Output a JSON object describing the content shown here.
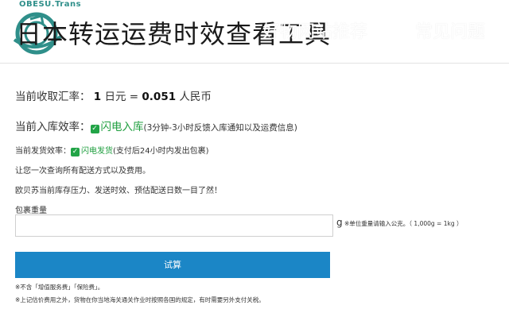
{
  "header": {
    "logo_text": "OBESU.Trans",
    "site_title": "日本转运运费时效查看工具",
    "nav": [
      "好物网站推荐",
      "常见问题"
    ]
  },
  "rate": {
    "label": "当前收取汇率：",
    "jpy": "1",
    "jpy_unit": "日元 =",
    "cny": "0.051",
    "cny_unit": "人民币"
  },
  "intake": {
    "label": "当前入库效率：",
    "status": "闪电入库",
    "note": "(3分钟-3小时反馈入库通知以及运费信息)"
  },
  "shipping": {
    "label": "当前发货效率：",
    "status": "闪电发货",
    "note": "(支付后24小时内发出包裹)"
  },
  "text": {
    "line1": "让您一次查询所有配送方式以及费用。",
    "line2": "欧贝苏当前库存压力、发送时效、预估配送日数一目了然！"
  },
  "form": {
    "weight_label": "包裹重量",
    "weight_value": "",
    "unit": "g",
    "unit_note": "※单位重量请输入公克。（ 1,000g = 1kg ）",
    "submit_label": "试算"
  },
  "footer": {
    "note1": "※不含「增值服务费」「保险费」。",
    "note2": "※上记估价费用之外，货物在你当地海关通关作业时按照各国的规定，有时需要另外支付关税。"
  },
  "colors": {
    "accent": "#1b86c6",
    "status_green": "#1e9e3e"
  }
}
